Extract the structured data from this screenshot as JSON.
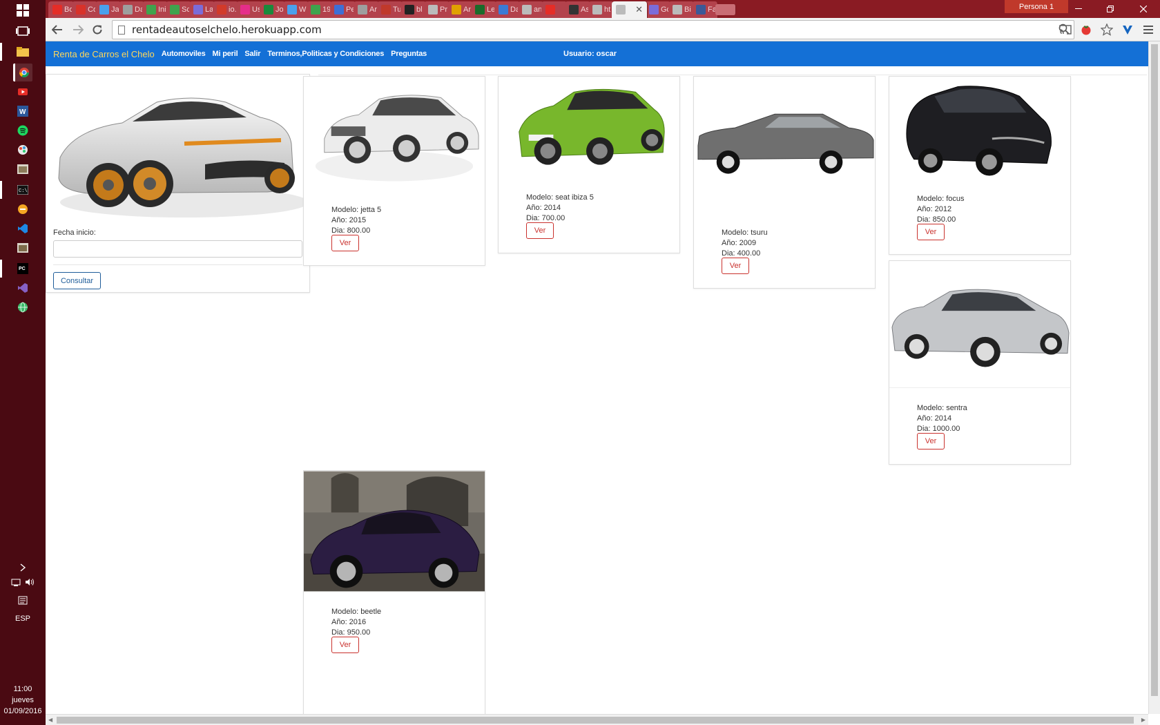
{
  "browser": {
    "tabs": [
      {
        "label": "Bo",
        "icon": "youtube-icon",
        "color": "#e52d27"
      },
      {
        "label": "Co",
        "icon": "red-square-icon",
        "color": "#d9322a"
      },
      {
        "label": "Jaj",
        "icon": "twitter-icon",
        "color": "#4aa0ec"
      },
      {
        "label": "Da",
        "icon": "doc-icon",
        "color": "#9e9e9e"
      },
      {
        "label": "Ini",
        "icon": "hex-icon",
        "color": "#3fa34d"
      },
      {
        "label": "Sc",
        "icon": "green-leaf-icon",
        "color": "#3fa34d"
      },
      {
        "label": "La",
        "icon": "purple-dot-icon",
        "color": "#7b6cd9"
      },
      {
        "label": "io.",
        "icon": "n-icon",
        "color": "#d23a2a"
      },
      {
        "label": "Us",
        "icon": "play-icon",
        "color": "#e52d8a"
      },
      {
        "label": "Jo",
        "icon": "m-icon",
        "color": "#1a8a3c"
      },
      {
        "label": "W",
        "icon": "twitter-icon",
        "color": "#4aa0ec"
      },
      {
        "label": "19",
        "icon": "leaf-icon",
        "color": "#3fa34d"
      },
      {
        "label": "Pe",
        "icon": "list-icon",
        "color": "#3d6fd6"
      },
      {
        "label": "Ar",
        "icon": "doc-icon",
        "color": "#9e9e9e"
      },
      {
        "label": "Tu",
        "icon": "a-icon",
        "color": "#c0392b"
      },
      {
        "label": "bl",
        "icon": "github-icon",
        "color": "#222222"
      },
      {
        "label": "Pr",
        "icon": "page-icon",
        "color": "#bbbbbb"
      },
      {
        "label": "Ar",
        "icon": "e-icon",
        "color": "#e0a100"
      },
      {
        "label": "Le",
        "icon": "k-icon",
        "color": "#1a6b2a"
      },
      {
        "label": "Da",
        "icon": "chevron-icon",
        "color": "#3a7bd5"
      },
      {
        "label": "an",
        "icon": "page-icon",
        "color": "#bbbbbb"
      },
      {
        "label": "",
        "icon": "youtube-icon",
        "color": "#e52d27"
      },
      {
        "label": "As",
        "icon": "pg-icon",
        "color": "#333333"
      },
      {
        "label": "ht",
        "icon": "page-icon",
        "color": "#bbbbbb"
      },
      {
        "label": "",
        "icon": "page-icon",
        "color": "#bbbbbb",
        "active": true
      },
      {
        "label": "Gc",
        "icon": "purple-dot-icon",
        "color": "#7b6cd9"
      },
      {
        "label": "Bi",
        "icon": "page-icon",
        "color": "#bbbbbb"
      },
      {
        "label": "Fa",
        "icon": "facebook-icon",
        "color": "#3b5998"
      },
      {
        "label": "",
        "icon": "new-tab-icon",
        "color": "#c96d74"
      }
    ],
    "profile": "Persona 1",
    "url": "rentadeautoselchelo.herokuapp.com"
  },
  "taskbar": {
    "language": "ESP",
    "time": "11:00",
    "day": "jueves",
    "date": "01/09/2016"
  },
  "site": {
    "brand": "Renta de Carros el Chelo",
    "nav": [
      "Automoviles",
      "Mi peril",
      "Salir",
      "Terminos,Politicas y Condiciones",
      "Preguntas"
    ],
    "user": "Usuario: oscar",
    "search": {
      "date_label": "Fecha inicio:",
      "date_value": "",
      "button": "Consultar"
    },
    "cars": [
      {
        "modelo": "Modelo: jetta 5",
        "anio": "Año: 2015",
        "dia": "Dia: 800.00",
        "button": "Ver",
        "color": "#e8e8e8"
      },
      {
        "modelo": "Modelo: seat ibiza 5",
        "anio": "Año: 2014",
        "dia": "Dia: 700.00",
        "button": "Ver",
        "color": "#7ab82e"
      },
      {
        "modelo": "Modelo: tsuru",
        "anio": "Año: 2009",
        "dia": "Dia: 400.00",
        "button": "Ver",
        "color": "#6d6d6d"
      },
      {
        "modelo": "Modelo: focus",
        "anio": "Año: 2012",
        "dia": "Dia: 850.00",
        "button": "Ver",
        "color": "#1f1f22"
      },
      {
        "modelo": "Modelo: sentra",
        "anio": "Año: 2014",
        "dia": "Dia: 1000.00",
        "button": "Ver",
        "color": "#b9bcc0"
      },
      {
        "modelo": "Modelo: beetle",
        "anio": "Año: 2016",
        "dia": "Dia: 950.00",
        "button": "Ver",
        "color": "#2a1c3d"
      }
    ]
  }
}
